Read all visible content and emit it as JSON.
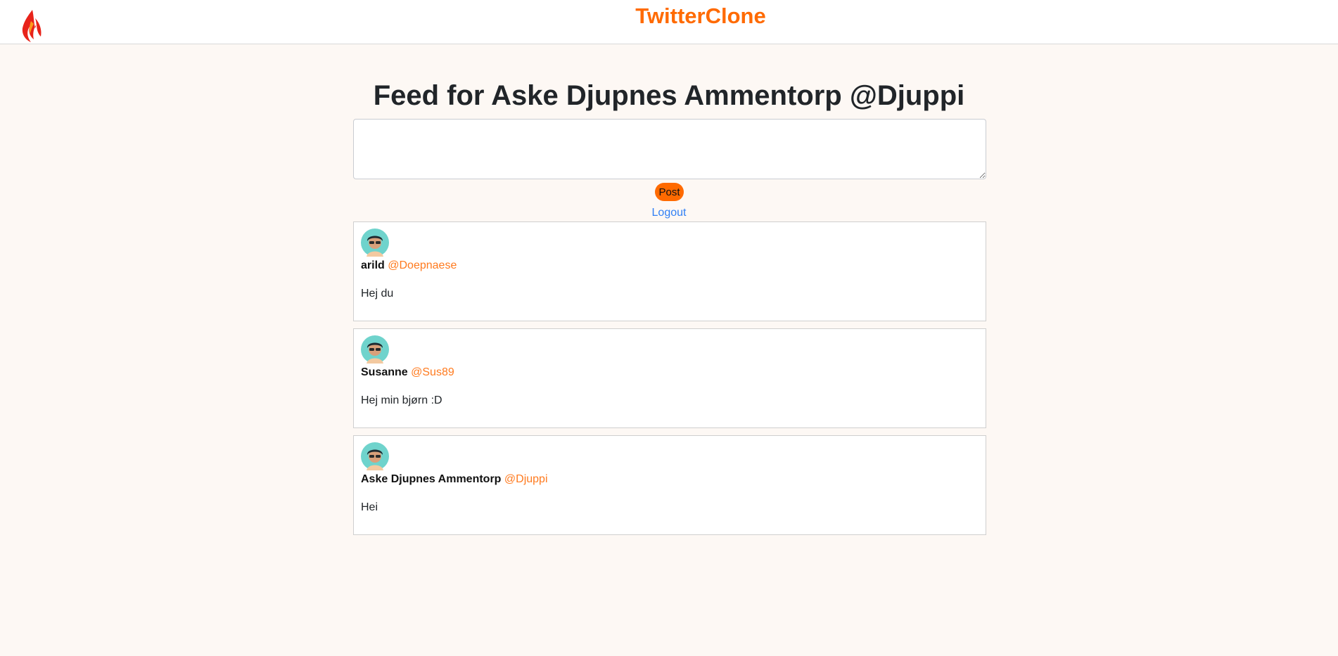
{
  "header": {
    "brand": "TwitterClone",
    "logo_icon": "phoenix-icon"
  },
  "feed": {
    "title": "Feed for Aske Djupnes Ammentorp @Djuppi",
    "composer_value": "",
    "post_label": "Post",
    "logout_label": "Logout"
  },
  "tweets": [
    {
      "name": "arild",
      "handle": "@Doepnaese",
      "text": "Hej du",
      "avatar_icon": "user-avatar-icon"
    },
    {
      "name": "Susanne",
      "handle": "@Sus89",
      "text": "Hej min bjørn :D",
      "avatar_icon": "user-avatar-icon"
    },
    {
      "name": "Aske Djupnes Ammentorp",
      "handle": "@Djuppi",
      "text": "Hei",
      "avatar_icon": "user-avatar-icon"
    }
  ],
  "colors": {
    "accent": "#ff6a00",
    "handle": "#ff7a1e",
    "link": "#2f7ff5",
    "background": "#fdf8f4"
  }
}
